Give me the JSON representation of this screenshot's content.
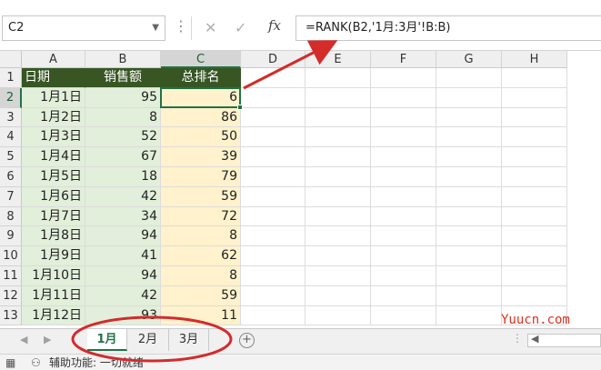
{
  "formula_bar": {
    "name_box": "C2",
    "cancel_icon": "✕",
    "enter_icon": "✓",
    "fx_label": "fx",
    "formula": "=RANK(B2,'1月:3月'!B:B)"
  },
  "grid": {
    "columns": [
      "A",
      "B",
      "C",
      "D",
      "E",
      "F",
      "G",
      "H"
    ],
    "rows": [
      "1",
      "2",
      "3",
      "4",
      "5",
      "6",
      "7",
      "8",
      "9",
      "10",
      "11",
      "12",
      "13"
    ],
    "header": {
      "a": "日期",
      "b": "销售额",
      "c": "总排名"
    },
    "data": [
      {
        "date": "1月1日",
        "sales": "95",
        "rank": "6"
      },
      {
        "date": "1月2日",
        "sales": "8",
        "rank": "86"
      },
      {
        "date": "1月3日",
        "sales": "52",
        "rank": "50"
      },
      {
        "date": "1月4日",
        "sales": "67",
        "rank": "39"
      },
      {
        "date": "1月5日",
        "sales": "18",
        "rank": "79"
      },
      {
        "date": "1月6日",
        "sales": "42",
        "rank": "59"
      },
      {
        "date": "1月7日",
        "sales": "34",
        "rank": "72"
      },
      {
        "date": "1月8日",
        "sales": "94",
        "rank": "8"
      },
      {
        "date": "1月9日",
        "sales": "41",
        "rank": "62"
      },
      {
        "date": "1月10日",
        "sales": "94",
        "rank": "8"
      },
      {
        "date": "1月11日",
        "sales": "42",
        "rank": "59"
      },
      {
        "date": "1月12日",
        "sales": "93",
        "rank": "11"
      }
    ],
    "active_cell": "C2"
  },
  "sheets": {
    "tabs": [
      "1月",
      "2月",
      "3月"
    ],
    "active": "1月",
    "add_label": "+"
  },
  "status": {
    "text": "辅助功能: 一切就绪"
  },
  "watermark": "Yuucn.com",
  "colors": {
    "header_fill": "#375623",
    "col_ab_fill": "#e2efda",
    "col_c_fill": "#fff2cc",
    "selection": "#217346",
    "annotation": "#d42b2b"
  }
}
